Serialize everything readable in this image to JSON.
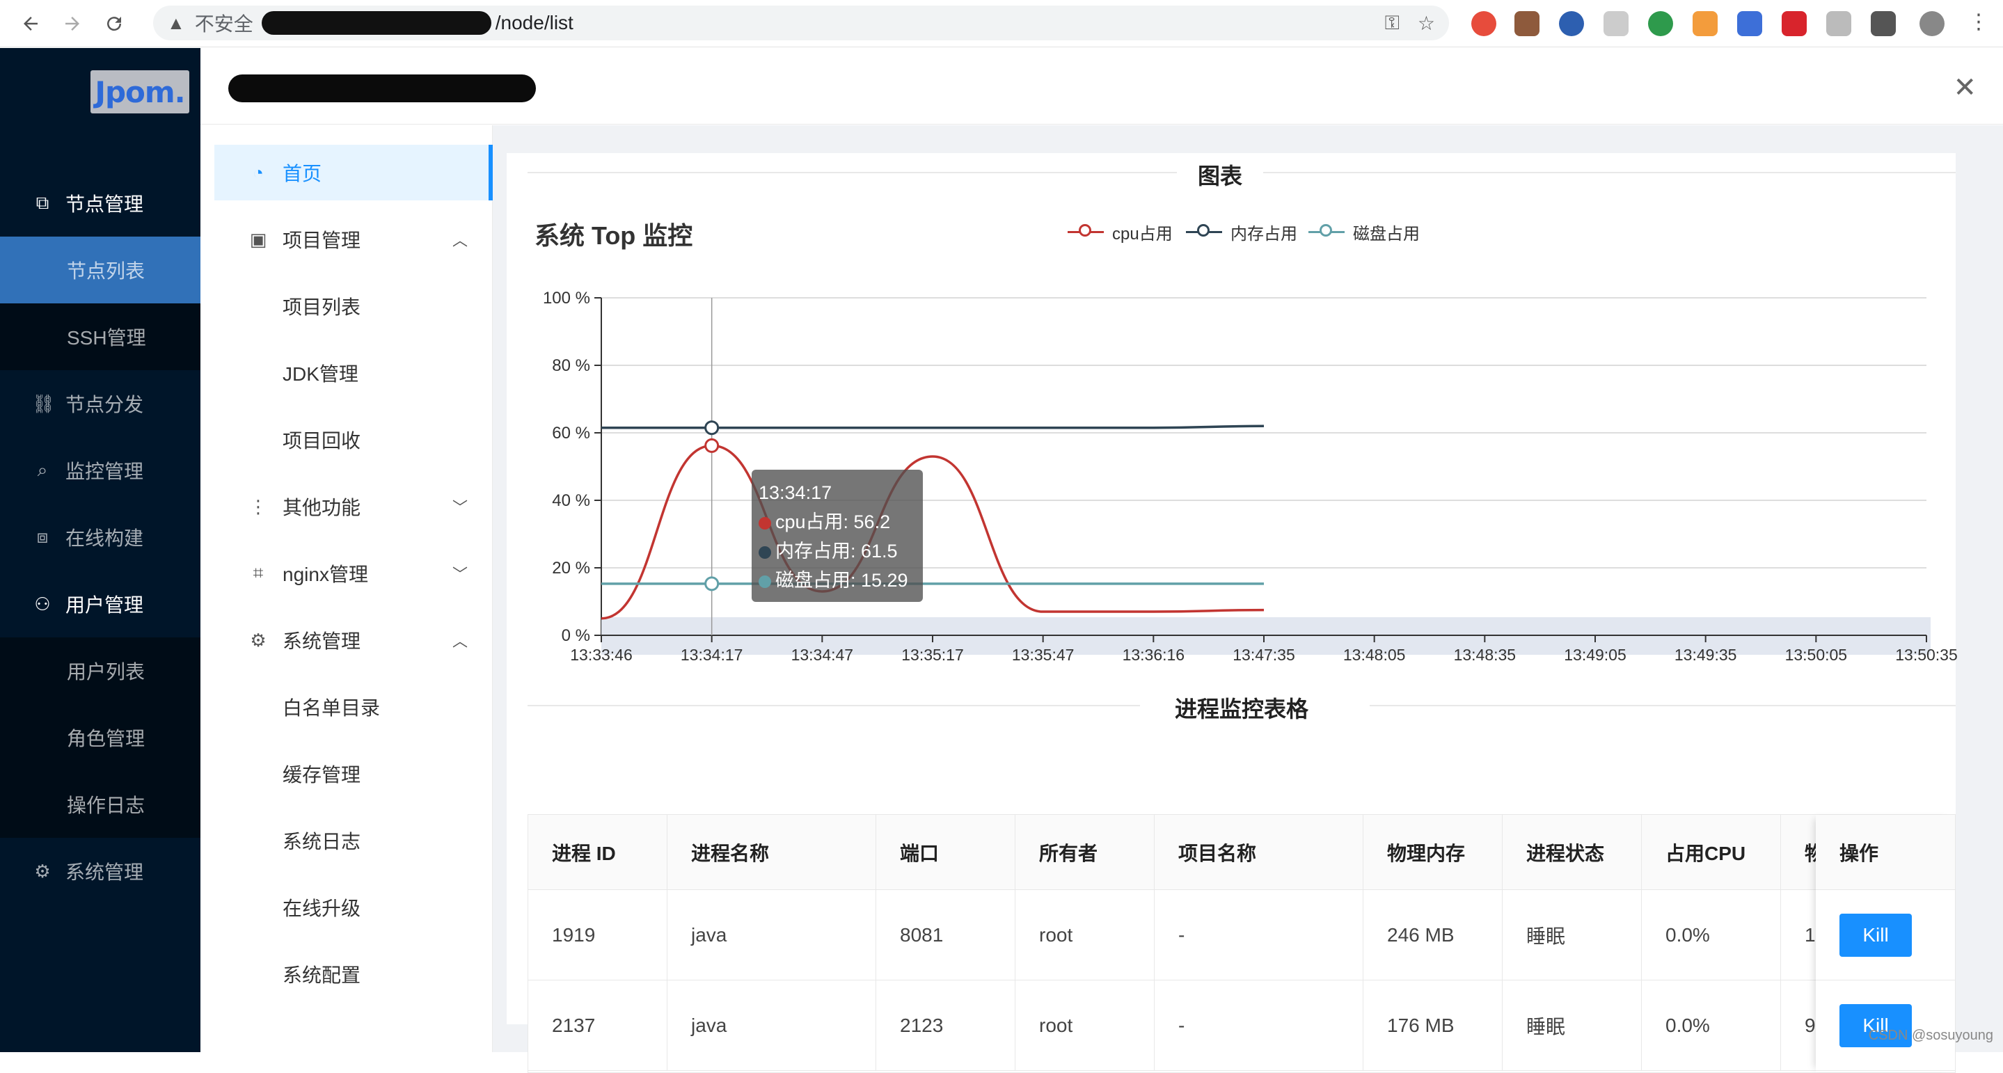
{
  "browser": {
    "insecure_label": "不安全",
    "path": "/node/list"
  },
  "sidebar": {
    "logo": "Jpom.",
    "items": [
      {
        "label": "节点管理",
        "icon": "node-icon"
      },
      {
        "label": "节点列表"
      },
      {
        "label": "SSH管理"
      },
      {
        "label": "节点分发",
        "icon": "sitemap-icon"
      },
      {
        "label": "监控管理",
        "icon": "monitor-icon"
      },
      {
        "label": "在线构建",
        "icon": "build-icon"
      },
      {
        "label": "用户管理",
        "icon": "user-icon"
      },
      {
        "label": "用户列表"
      },
      {
        "label": "角色管理"
      },
      {
        "label": "操作日志"
      },
      {
        "label": "系统管理",
        "icon": "gear-icon"
      }
    ]
  },
  "menu2": {
    "items": [
      {
        "label": "首页"
      },
      {
        "label": "项目管理"
      },
      {
        "label": "项目列表"
      },
      {
        "label": "JDK管理"
      },
      {
        "label": "项目回收"
      },
      {
        "label": "其他功能"
      },
      {
        "label": "nginx管理"
      },
      {
        "label": "系统管理"
      },
      {
        "label": "白名单目录"
      },
      {
        "label": "缓存管理"
      },
      {
        "label": "系统日志"
      },
      {
        "label": "在线升级"
      },
      {
        "label": "系统配置"
      }
    ]
  },
  "main": {
    "section_chart": "图表",
    "section_table": "进程监控表格"
  },
  "chart_data": {
    "type": "line",
    "title": "系统 Top 监控",
    "x": [
      "13:33:46",
      "13:34:17",
      "13:34:47",
      "13:35:17",
      "13:35:47",
      "13:36:16",
      "13:47:35",
      "13:48:05",
      "13:48:35",
      "13:49:05",
      "13:49:35",
      "13:50:05",
      "13:50:35"
    ],
    "ylim": [
      0,
      100
    ],
    "yticks": [
      "0 %",
      "20 %",
      "40 %",
      "60 %",
      "80 %",
      "100 %"
    ],
    "series": [
      {
        "name": "cpu占用",
        "color": "#c23531",
        "values": [
          5,
          56.2,
          13,
          53,
          7,
          7,
          7.5
        ]
      },
      {
        "name": "内存占用",
        "color": "#2f4554",
        "values": [
          61.5,
          61.5,
          61.5,
          61.5,
          61.5,
          61.5,
          62
        ]
      },
      {
        "name": "磁盘占用",
        "color": "#61a0a8",
        "values": [
          15.29,
          15.29,
          15.29,
          15.29,
          15.29,
          15.29,
          15.29
        ]
      }
    ],
    "tooltip": {
      "time": "13:34:17",
      "cpu": "cpu占用: 56.2",
      "mem": "内存占用: 61.5",
      "disk": "磁盘占用: 15.29"
    }
  },
  "table": {
    "headers": [
      "进程 ID",
      "进程名称",
      "端口",
      "所有者",
      "项目名称",
      "物理内存",
      "进程状态",
      "占用CPU",
      "物"
    ],
    "action_header": "操作",
    "rows": [
      [
        "1919",
        "java",
        "8081",
        "root",
        "-",
        "246 MB",
        "睡眠",
        "0.0%",
        "1"
      ],
      [
        "2137",
        "java",
        "2123",
        "root",
        "-",
        "176 MB",
        "睡眠",
        "0.0%",
        "9"
      ]
    ],
    "kill_label": "Kill"
  },
  "watermark": "CSDN @sosuyoung"
}
